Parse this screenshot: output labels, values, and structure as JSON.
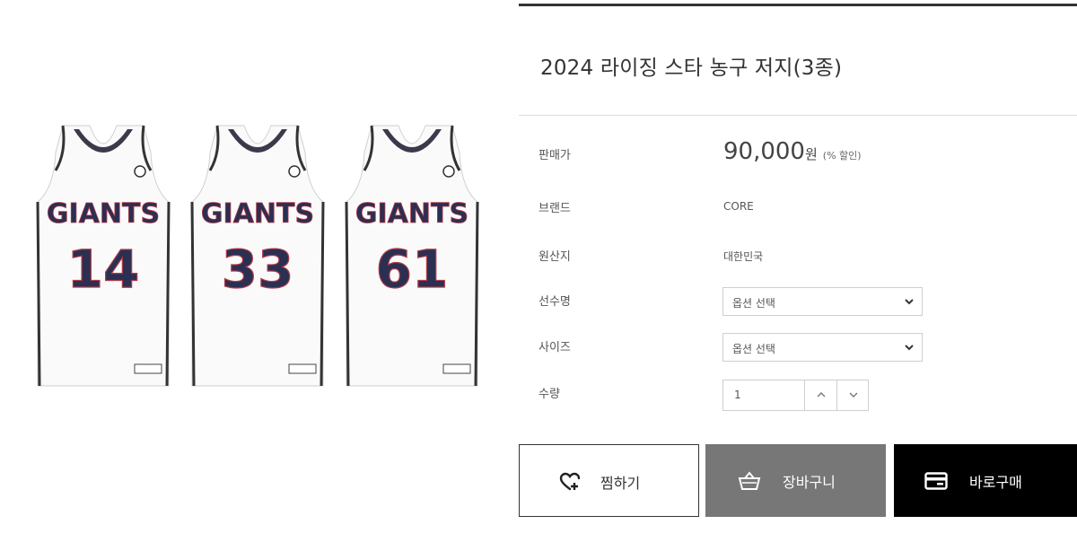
{
  "product": {
    "title": "2024 라이징 스타 농구 저지(3종)",
    "jerseys": [
      {
        "team": "GIANTS",
        "number": "14"
      },
      {
        "team": "GIANTS",
        "number": "33"
      },
      {
        "team": "GIANTS",
        "number": "61"
      }
    ]
  },
  "info": {
    "price_label": "판매가",
    "price_value": "90,000",
    "price_unit": "원",
    "discount": "(% 할인)",
    "brand_label": "브랜드",
    "brand_value": "CORE",
    "origin_label": "원산지",
    "origin_value": "대한민국",
    "player_label": "선수명",
    "player_select": "옵션 선택",
    "size_label": "사이즈",
    "size_select": "옵션 선택",
    "qty_label": "수량",
    "qty_value": "1"
  },
  "actions": {
    "wish": "찜하기",
    "cart": "장바구니",
    "buy": "바로구매"
  },
  "icons": [
    "heart-plus-icon",
    "basket-icon",
    "card-icon",
    "chevron-down-icon",
    "chevron-up-icon"
  ],
  "colors": {
    "cart_bg": "#777777",
    "buy_bg": "#000000",
    "jersey_navy": "#2b2f52",
    "jersey_red": "#b03a48"
  }
}
